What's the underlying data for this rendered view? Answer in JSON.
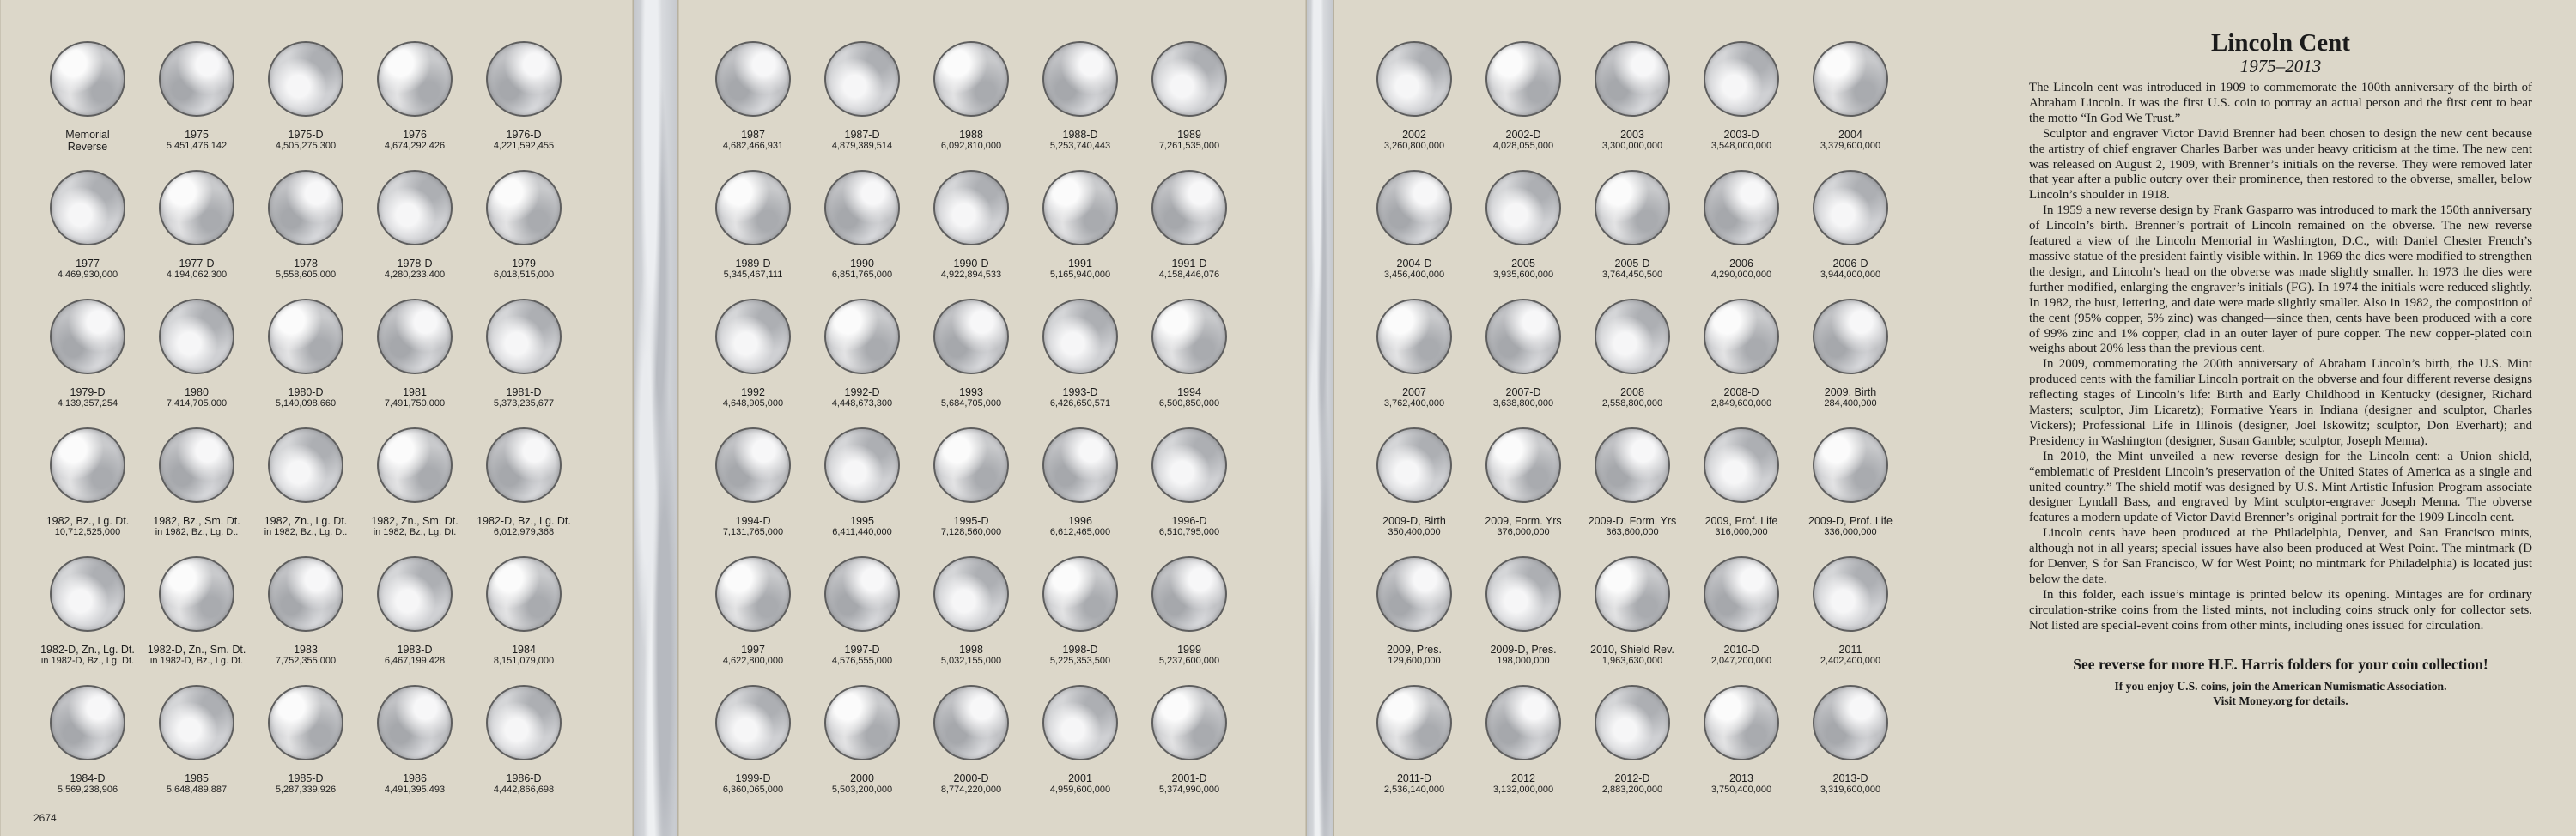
{
  "folder_number": "2674",
  "text_panel": {
    "title": "Lincoln Cent",
    "subtitle": "1975–2013",
    "paragraphs": [
      "The Lincoln cent was introduced in 1909 to commemorate the 100th anniversary of the birth of Abraham Lincoln. It was the first U.S. coin to portray an actual person and the first cent to bear the motto “In God We Trust.”",
      "Sculptor and engraver Victor David Brenner had been chosen to design the new cent because the artistry of chief engraver Charles Barber was under heavy criticism at the time. The new cent was released on August 2, 1909, with Brenner’s initials on the reverse. They were removed later that year after a public outcry over their prominence, then restored to the obverse, smaller, below Lincoln’s shoulder in 1918.",
      "In 1959 a new reverse design by Frank Gasparro was introduced to mark the 150th anniversary of Lincoln’s birth. Brenner’s portrait of Lincoln remained on the obverse. The new reverse featured a view of the Lincoln Memorial in Washington, D.C., with Daniel Chester French’s massive statue of the president faintly visible within. In 1969 the dies were modified to strengthen the design, and Lincoln’s head on the obverse was made slightly smaller. In 1973 the dies were further modified, enlarging the engraver’s initials (FG). In 1974 the initials were reduced slightly. In 1982, the bust, lettering, and date were made slightly smaller. Also in 1982, the composition of the cent (95% copper, 5% zinc) was changed—since then, cents have been produced with a core of 99% zinc and 1% copper, clad in an outer layer of pure copper. The new copper-plated coin weighs about 20% less than the previous cent.",
      "In 2009, commemorating the 200th anniversary of Abraham Lincoln’s birth, the U.S. Mint produced cents with the familiar Lincoln portrait on the obverse and four different reverse designs reflecting stages of Lincoln’s life: Birth and Early Childhood in Kentucky (designer, Richard Masters; sculptor, Jim Licaretz); Formative Years in Indiana (designer and sculptor, Charles Vickers); Professional Life in Illinois (designer, Joel Iskowitz; sculptor, Don Everhart); and Presidency in Washington (designer, Susan Gamble; sculptor, Joseph Menna).",
      "In 2010, the Mint unveiled a new reverse design for the Lincoln cent: a Union shield, “emblematic of President Lincoln’s preservation of the United States of America as a single and united country.” The shield motif was designed by U.S. Mint Artistic Infusion Program associate designer Lyndall Bass, and engraved by Mint sculptor-engraver Joseph Menna. The obverse features a modern update of Victor David Brenner’s original portrait for the 1909 Lincoln cent.",
      "Lincoln cents have been produced at the Philadelphia, Denver, and San Francisco mints, although not in all years; special issues have also been produced at West Point. The mintmark (D for Denver, S for San Francisco, W for West Point; no mintmark for Philadelphia) is located just below the date.",
      "In this folder, each issue’s mintage is printed below its opening. Mintages are for ordinary circulation-strike coins from the listed mints, not including coins struck only for collector sets. Not listed are special-event coins from other mints, including ones issued for circulation."
    ],
    "cta": "See reverse for more H.E. Harris folders for your coin collection!",
    "footer_line1": "If you enjoy U.S. coins, join the American Numismatic Association.",
    "footer_line2": "Visit Money.org for details."
  },
  "panels": [
    {
      "rows": [
        [
          [
            "Memorial",
            "Reverse"
          ],
          [
            "1975",
            "5,451,476,142"
          ],
          [
            "1975-D",
            "4,505,275,300"
          ],
          [
            "1976",
            "4,674,292,426"
          ],
          [
            "1976-D",
            "4,221,592,455"
          ]
        ],
        [
          [
            "1977",
            "4,469,930,000"
          ],
          [
            "1977-D",
            "4,194,062,300"
          ],
          [
            "1978",
            "5,558,605,000"
          ],
          [
            "1978-D",
            "4,280,233,400"
          ],
          [
            "1979",
            "6,018,515,000"
          ]
        ],
        [
          [
            "1979-D",
            "4,139,357,254"
          ],
          [
            "1980",
            "7,414,705,000"
          ],
          [
            "1980-D",
            "5,140,098,660"
          ],
          [
            "1981",
            "7,491,750,000"
          ],
          [
            "1981-D",
            "5,373,235,677"
          ]
        ],
        [
          [
            "1982, Bz., Lg. Dt.",
            "10,712,525,000"
          ],
          [
            "1982, Bz., Sm. Dt.",
            "in 1982, Bz., Lg. Dt."
          ],
          [
            "1982, Zn., Lg. Dt.",
            "in 1982, Bz., Lg. Dt."
          ],
          [
            "1982, Zn., Sm. Dt.",
            "in 1982, Bz., Lg. Dt."
          ],
          [
            "1982-D, Bz., Lg. Dt.",
            "6,012,979,368"
          ]
        ],
        [
          [
            "1982-D, Zn., Lg. Dt.",
            "in 1982-D, Bz., Lg. Dt."
          ],
          [
            "1982-D, Zn., Sm. Dt.",
            "in 1982-D, Bz., Lg. Dt."
          ],
          [
            "1983",
            "7,752,355,000"
          ],
          [
            "1983-D",
            "6,467,199,428"
          ],
          [
            "1984",
            "8,151,079,000"
          ]
        ],
        [
          [
            "1984-D",
            "5,569,238,906"
          ],
          [
            "1985",
            "5,648,489,887"
          ],
          [
            "1985-D",
            "5,287,339,926"
          ],
          [
            "1986",
            "4,491,395,493"
          ],
          [
            "1986-D",
            "4,442,866,698"
          ]
        ]
      ]
    },
    {
      "rows": [
        [
          [
            "1987",
            "4,682,466,931"
          ],
          [
            "1987-D",
            "4,879,389,514"
          ],
          [
            "1988",
            "6,092,810,000"
          ],
          [
            "1988-D",
            "5,253,740,443"
          ],
          [
            "1989",
            "7,261,535,000"
          ]
        ],
        [
          [
            "1989-D",
            "5,345,467,111"
          ],
          [
            "1990",
            "6,851,765,000"
          ],
          [
            "1990-D",
            "4,922,894,533"
          ],
          [
            "1991",
            "5,165,940,000"
          ],
          [
            "1991-D",
            "4,158,446,076"
          ]
        ],
        [
          [
            "1992",
            "4,648,905,000"
          ],
          [
            "1992-D",
            "4,448,673,300"
          ],
          [
            "1993",
            "5,684,705,000"
          ],
          [
            "1993-D",
            "6,426,650,571"
          ],
          [
            "1994",
            "6,500,850,000"
          ]
        ],
        [
          [
            "1994-D",
            "7,131,765,000"
          ],
          [
            "1995",
            "6,411,440,000"
          ],
          [
            "1995-D",
            "7,128,560,000"
          ],
          [
            "1996",
            "6,612,465,000"
          ],
          [
            "1996-D",
            "6,510,795,000"
          ]
        ],
        [
          [
            "1997",
            "4,622,800,000"
          ],
          [
            "1997-D",
            "4,576,555,000"
          ],
          [
            "1998",
            "5,032,155,000"
          ],
          [
            "1998-D",
            "5,225,353,500"
          ],
          [
            "1999",
            "5,237,600,000"
          ]
        ],
        [
          [
            "1999-D",
            "6,360,065,000"
          ],
          [
            "2000",
            "5,503,200,000"
          ],
          [
            "2000-D",
            "8,774,220,000"
          ],
          [
            "2001",
            "4,959,600,000"
          ],
          [
            "2001-D",
            "5,374,990,000"
          ]
        ]
      ]
    },
    {
      "rows": [
        [
          [
            "2002",
            "3,260,800,000"
          ],
          [
            "2002-D",
            "4,028,055,000"
          ],
          [
            "2003",
            "3,300,000,000"
          ],
          [
            "2003-D",
            "3,548,000,000"
          ],
          [
            "2004",
            "3,379,600,000"
          ]
        ],
        [
          [
            "2004-D",
            "3,456,400,000"
          ],
          [
            "2005",
            "3,935,600,000"
          ],
          [
            "2005-D",
            "3,764,450,500"
          ],
          [
            "2006",
            "4,290,000,000"
          ],
          [
            "2006-D",
            "3,944,000,000"
          ]
        ],
        [
          [
            "2007",
            "3,762,400,000"
          ],
          [
            "2007-D",
            "3,638,800,000"
          ],
          [
            "2008",
            "2,558,800,000"
          ],
          [
            "2008-D",
            "2,849,600,000"
          ],
          [
            "2009, Birth",
            "284,400,000"
          ]
        ],
        [
          [
            "2009-D, Birth",
            "350,400,000"
          ],
          [
            "2009, Form. Yrs",
            "376,000,000"
          ],
          [
            "2009-D, Form. Yrs",
            "363,600,000"
          ],
          [
            "2009, Prof. Life",
            "316,000,000"
          ],
          [
            "2009-D, Prof. Life",
            "336,000,000"
          ]
        ],
        [
          [
            "2009, Pres.",
            "129,600,000"
          ],
          [
            "2009-D, Pres.",
            "198,000,000"
          ],
          [
            "2010, Shield Rev.",
            "1,963,630,000"
          ],
          [
            "2010-D",
            "2,047,200,000"
          ],
          [
            "2011",
            "2,402,400,000"
          ]
        ],
        [
          [
            "2011-D",
            "2,536,140,000"
          ],
          [
            "2012",
            "3,132,000,000"
          ],
          [
            "2012-D",
            "2,883,200,000"
          ],
          [
            "2013",
            "3,750,400,000"
          ],
          [
            "2013-D",
            "3,319,600,000"
          ]
        ]
      ]
    }
  ]
}
